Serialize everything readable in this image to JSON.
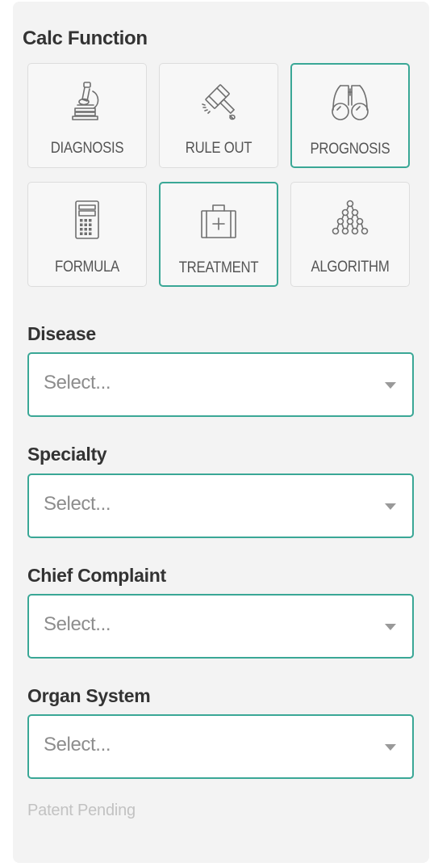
{
  "panel": {
    "title": "Calc Function"
  },
  "functions": [
    {
      "label": "DIAGNOSIS",
      "icon": "microscope-icon",
      "selected": false
    },
    {
      "label": "RULE OUT",
      "icon": "gavel-icon",
      "selected": false
    },
    {
      "label": "PROGNOSIS",
      "icon": "binoculars-icon",
      "selected": true
    },
    {
      "label": "FORMULA",
      "icon": "calculator-icon",
      "selected": false
    },
    {
      "label": "TREATMENT",
      "icon": "medical-kit-icon",
      "selected": true
    },
    {
      "label": "ALGORITHM",
      "icon": "tree-network-icon",
      "selected": false
    }
  ],
  "filters": {
    "disease": {
      "label": "Disease",
      "placeholder": "Select..."
    },
    "specialty": {
      "label": "Specialty",
      "placeholder": "Select..."
    },
    "chief_complaint": {
      "label": "Chief Complaint",
      "placeholder": "Select..."
    },
    "organ_system": {
      "label": "Organ System",
      "placeholder": "Select..."
    }
  },
  "footer": {
    "note": "Patent Pending"
  },
  "colors": {
    "accent": "#3aa796",
    "panel_bg": "#f3f3f3",
    "icon_stroke": "#6f6f6f"
  }
}
